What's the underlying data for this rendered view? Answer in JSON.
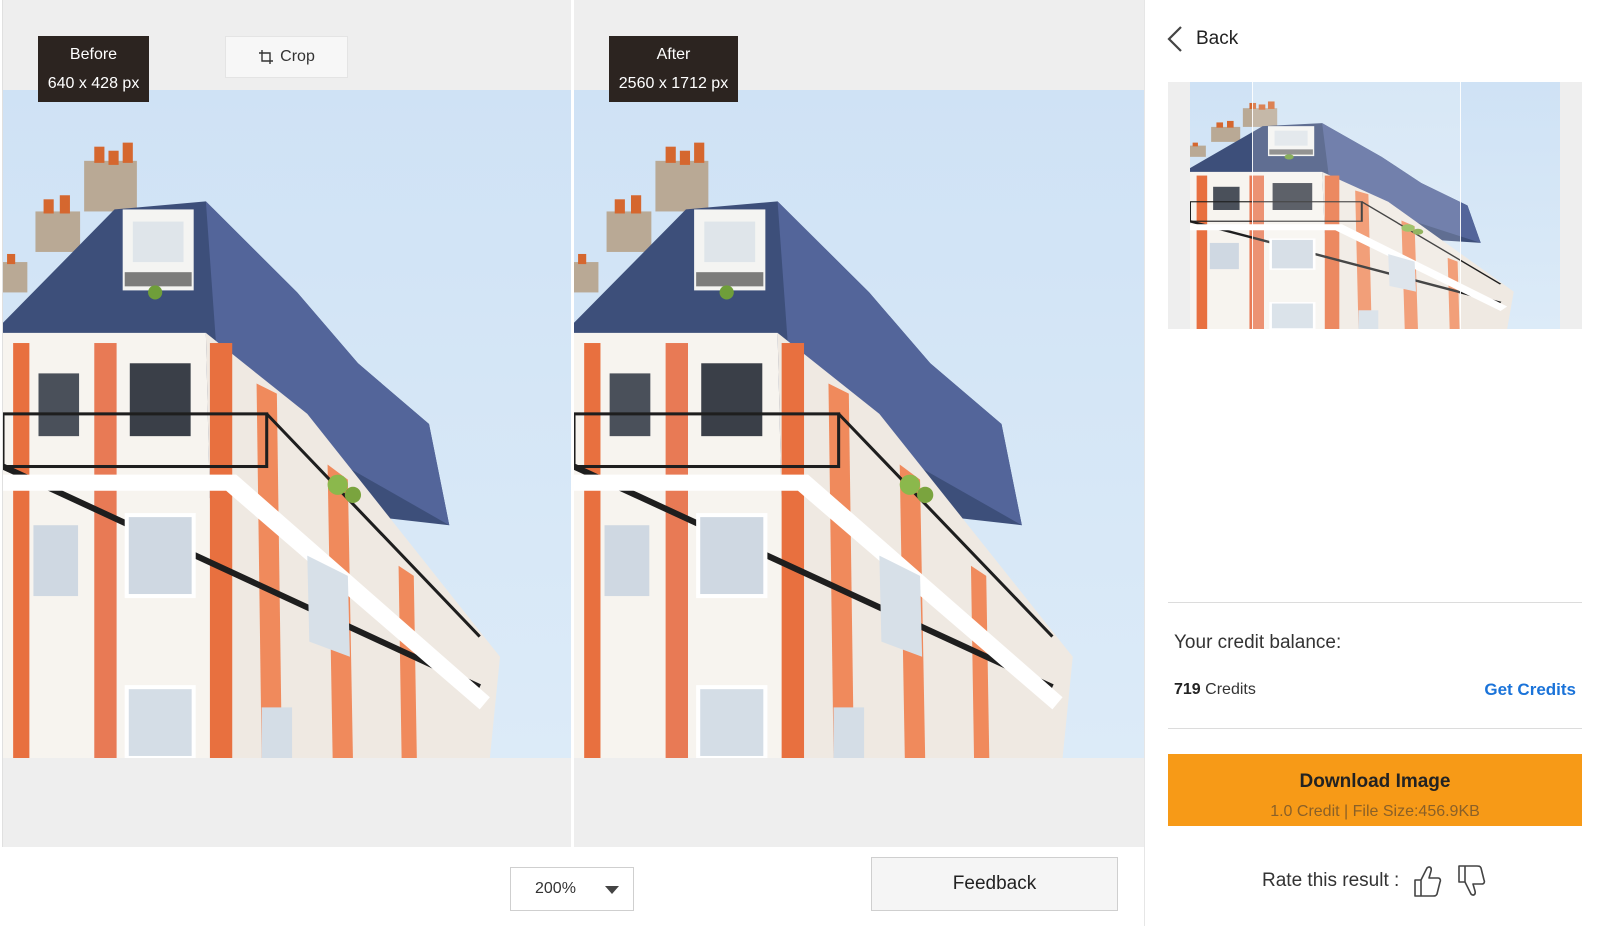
{
  "compare": {
    "before": {
      "label": "Before",
      "size": "640 x 428 px"
    },
    "after": {
      "label": "After",
      "size": "2560 x 1712 px"
    },
    "crop_label": "Crop"
  },
  "toolbar": {
    "zoom_value": "200%",
    "feedback_label": "Feedback"
  },
  "sidebar": {
    "back_label": "Back",
    "credit_label": "Your credit balance:",
    "credit_count": "719",
    "credit_unit": "Credits",
    "get_credits_label": "Get Credits",
    "download_label": "Download Image",
    "download_sub": "1.0 Credit | File Size:456.9KB",
    "rate_label": "Rate this result :"
  },
  "colors": {
    "accent": "#f79a17",
    "link": "#1a73d9",
    "badge": "#2c2420"
  },
  "icons": [
    "crop-icon",
    "chevron-left-icon",
    "chevron-down-icon",
    "thumbs-up-icon",
    "thumbs-down-icon"
  ]
}
